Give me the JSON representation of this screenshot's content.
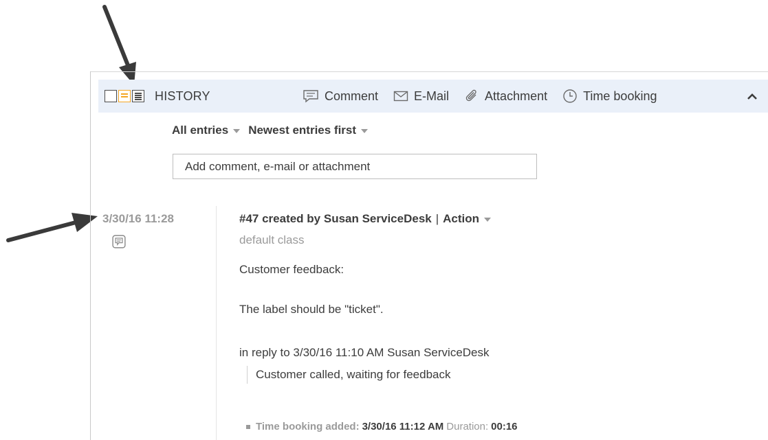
{
  "toolbar": {
    "title": "HISTORY",
    "actions": {
      "comment": "Comment",
      "email": "E-Mail",
      "attachment": "Attachment",
      "time_booking": "Time booking"
    },
    "active_view_color": "#f5a623",
    "view_buttons": [
      "compact-view-icon",
      "standard-view-icon",
      "detailed-view-icon"
    ]
  },
  "filters": {
    "entries": "All entries",
    "order": "Newest entries first"
  },
  "comment_input": {
    "placeholder": "Add comment, e-mail or attachment"
  },
  "entry": {
    "timestamp": "3/30/16 11:28",
    "number": "#47 created by Susan ServiceDesk",
    "separator": "|",
    "action": "Action",
    "class": "default class",
    "line1": "Customer feedback:",
    "line2": "The label should be \"ticket\".",
    "reply": "in reply to 3/30/16 11:10 AM Susan ServiceDesk",
    "quote": "Customer called, waiting for feedback"
  },
  "time_booking_entry": {
    "label": "Time booking added:",
    "time": "3/30/16 11:12 AM",
    "duration_label": "Duration:",
    "duration": "00:16"
  }
}
